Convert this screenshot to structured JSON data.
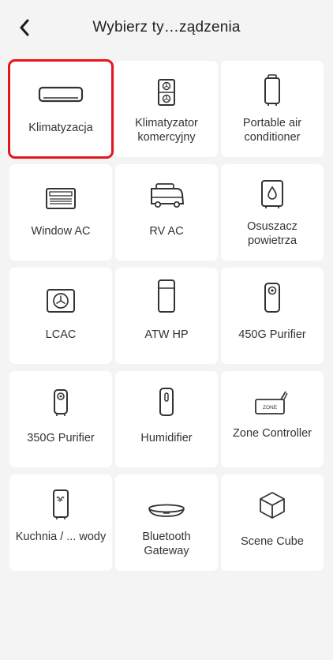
{
  "header": {
    "title": "Wybierz ty…ządzenia",
    "back_icon": "chevron-left-icon"
  },
  "accent_color": "#e5151d",
  "devices": [
    {
      "label": "Klimatyzacja",
      "icon": "split-ac-icon",
      "selected": true
    },
    {
      "label": "Klimatyzator komercyjny",
      "icon": "commercial-ac-icon",
      "selected": false
    },
    {
      "label": "Portable air conditioner",
      "icon": "portable-ac-icon",
      "selected": false
    },
    {
      "label": "Window AC",
      "icon": "window-ac-icon",
      "selected": false
    },
    {
      "label": "RV AC",
      "icon": "rv-icon",
      "selected": false
    },
    {
      "label": "Osuszacz powietrza",
      "icon": "dehumidifier-icon",
      "selected": false
    },
    {
      "label": "LCAC",
      "icon": "fan-unit-icon",
      "selected": false
    },
    {
      "label": "ATW HP",
      "icon": "heat-pump-icon",
      "selected": false
    },
    {
      "label": "450G Purifier",
      "icon": "purifier-icon",
      "selected": false
    },
    {
      "label": "350G Purifier",
      "icon": "small-purifier-icon",
      "selected": false
    },
    {
      "label": "Humidifier",
      "icon": "humidifier-icon",
      "selected": false
    },
    {
      "label": "Zone Controller",
      "icon": "zone-controller-icon",
      "selected": false
    },
    {
      "label": "Kuchnia / ... wody",
      "icon": "water-heater-icon",
      "selected": false
    },
    {
      "label": "Bluetooth Gateway",
      "icon": "bluetooth-gateway-icon",
      "selected": false
    },
    {
      "label": "Scene Cube",
      "icon": "cube-icon",
      "selected": false
    }
  ]
}
